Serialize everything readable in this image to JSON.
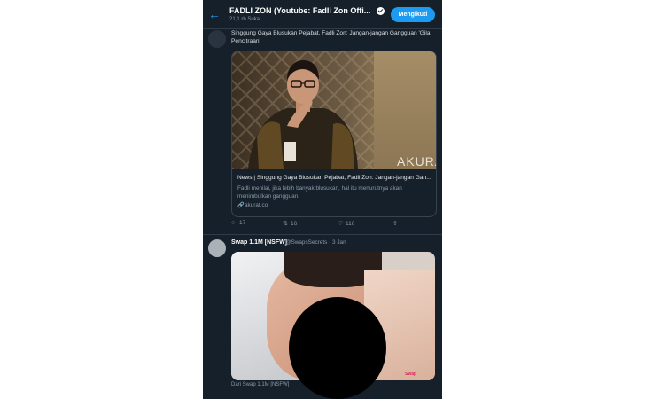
{
  "header": {
    "title": "FADLI ZON (Youtube: Fadli Zon Offi...",
    "subtitle": "21,1 rb Suka",
    "follow_label": "Mengikuti"
  },
  "tweet1": {
    "text": "Singgung Gaya Blusukan Pejabat, Fadli Zon: Jangan-jangan Gangguan 'Gila Pencitraan'",
    "card": {
      "watermark": "AKURAT",
      "title": "News | Singgung Gaya Blusukan Pejabat, Fadli Zon: Jangan-jangan Gan...",
      "description": "Fadli menilai, jika lebih banyak blusukan, hal itu menurutnya akan menimbulkan gangguan.",
      "domain": "akurat.co"
    },
    "actions": {
      "replies": "17",
      "retweets": "16",
      "likes": "116"
    }
  },
  "tweet2": {
    "name": "Swap 1.1M [NSFW]",
    "handle": "@SwapsSecrets · 3 Jan",
    "media_mark": "Swap",
    "footer": "Dari Swap 1.1M [NSFW]"
  },
  "icons": {
    "back": "arrow-left-icon",
    "verified": "verified-badge-icon",
    "link": "link-icon",
    "reply": "reply-icon",
    "retweet": "retweet-icon",
    "like": "heart-icon",
    "share": "share-icon"
  },
  "colors": {
    "background": "#15202b",
    "accent": "#1d9bf0",
    "muted_text": "#8b98a5"
  }
}
